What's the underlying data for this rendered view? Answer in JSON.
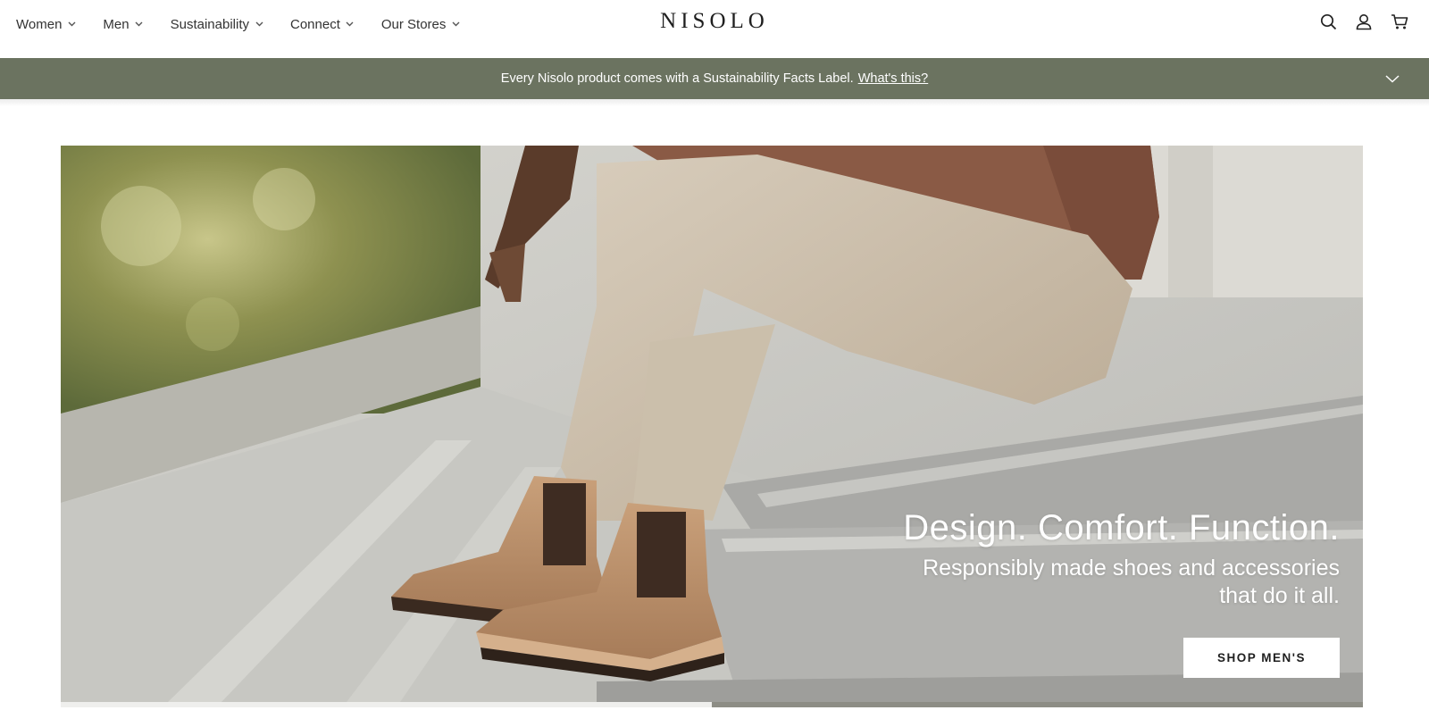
{
  "header": {
    "nav": [
      {
        "label": "Women"
      },
      {
        "label": "Men"
      },
      {
        "label": "Sustainability"
      },
      {
        "label": "Connect"
      },
      {
        "label": "Our Stores"
      }
    ],
    "logo": "NISOLO",
    "icons": [
      "search-icon",
      "account-icon",
      "cart-icon"
    ]
  },
  "announcement": {
    "text": "Every Nisolo product comes with a Sustainability Facts Label.",
    "link": "What's this?",
    "background": "#6b7360"
  },
  "hero": {
    "title": "Design. Comfort. Function.",
    "subtitle": "Responsibly made shoes and accessories that do it all.",
    "cta": "SHOP MEN'S"
  },
  "slideshow": {
    "slides": 2,
    "progress": 0.5
  }
}
